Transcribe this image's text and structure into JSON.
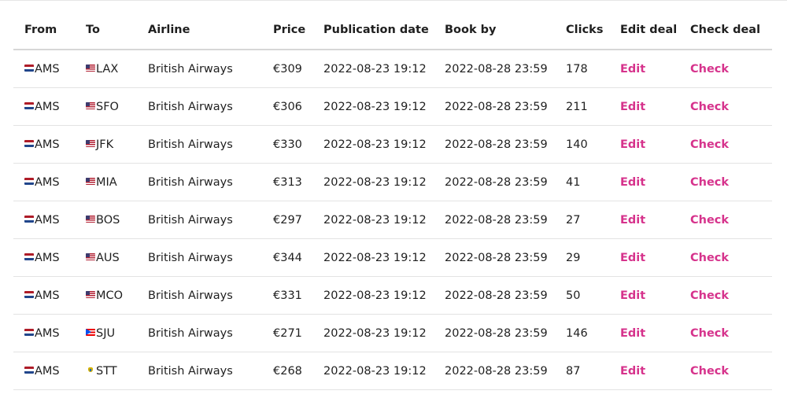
{
  "table": {
    "headers": {
      "from": "From",
      "to": "To",
      "airline": "Airline",
      "price": "Price",
      "publication_date": "Publication date",
      "book_by": "Book by",
      "clicks": "Clicks",
      "edit_deal": "Edit deal",
      "check_deal": "Check deal"
    },
    "rows": [
      {
        "from": "AMS",
        "from_flag": "netherlands-flag-icon",
        "to": "LAX",
        "to_flag": "usa-flag-icon",
        "airline": "British Airways",
        "price": "€309",
        "publication_date": "2022-08-23 19:12",
        "book_by": "2022-08-28 23:59",
        "clicks": "178",
        "edit": "Edit",
        "check": "Check"
      },
      {
        "from": "AMS",
        "from_flag": "netherlands-flag-icon",
        "to": "SFO",
        "to_flag": "usa-flag-icon",
        "airline": "British Airways",
        "price": "€306",
        "publication_date": "2022-08-23 19:12",
        "book_by": "2022-08-28 23:59",
        "clicks": "211",
        "edit": "Edit",
        "check": "Check"
      },
      {
        "from": "AMS",
        "from_flag": "netherlands-flag-icon",
        "to": "JFK",
        "to_flag": "usa-flag-icon",
        "airline": "British Airways",
        "price": "€330",
        "publication_date": "2022-08-23 19:12",
        "book_by": "2022-08-28 23:59",
        "clicks": "140",
        "edit": "Edit",
        "check": "Check"
      },
      {
        "from": "AMS",
        "from_flag": "netherlands-flag-icon",
        "to": "MIA",
        "to_flag": "usa-flag-icon",
        "airline": "British Airways",
        "price": "€313",
        "publication_date": "2022-08-23 19:12",
        "book_by": "2022-08-28 23:59",
        "clicks": "41",
        "edit": "Edit",
        "check": "Check"
      },
      {
        "from": "AMS",
        "from_flag": "netherlands-flag-icon",
        "to": "BOS",
        "to_flag": "usa-flag-icon",
        "airline": "British Airways",
        "price": "€297",
        "publication_date": "2022-08-23 19:12",
        "book_by": "2022-08-28 23:59",
        "clicks": "27",
        "edit": "Edit",
        "check": "Check"
      },
      {
        "from": "AMS",
        "from_flag": "netherlands-flag-icon",
        "to": "AUS",
        "to_flag": "usa-flag-icon",
        "airline": "British Airways",
        "price": "€344",
        "publication_date": "2022-08-23 19:12",
        "book_by": "2022-08-28 23:59",
        "clicks": "29",
        "edit": "Edit",
        "check": "Check"
      },
      {
        "from": "AMS",
        "from_flag": "netherlands-flag-icon",
        "to": "MCO",
        "to_flag": "usa-flag-icon",
        "airline": "British Airways",
        "price": "€331",
        "publication_date": "2022-08-23 19:12",
        "book_by": "2022-08-28 23:59",
        "clicks": "50",
        "edit": "Edit",
        "check": "Check"
      },
      {
        "from": "AMS",
        "from_flag": "netherlands-flag-icon",
        "to": "SJU",
        "to_flag": "puerto-rico-flag-icon",
        "airline": "British Airways",
        "price": "€271",
        "publication_date": "2022-08-23 19:12",
        "book_by": "2022-08-28 23:59",
        "clicks": "146",
        "edit": "Edit",
        "check": "Check"
      },
      {
        "from": "AMS",
        "from_flag": "netherlands-flag-icon",
        "to": "STT",
        "to_flag": "us-virgin-islands-flag-icon",
        "airline": "British Airways",
        "price": "€268",
        "publication_date": "2022-08-23 19:12",
        "book_by": "2022-08-28 23:59",
        "clicks": "87",
        "edit": "Edit",
        "check": "Check"
      }
    ]
  },
  "colors": {
    "link": "#d6338c",
    "text": "#1f1f1f",
    "divider": "#e3e3e3",
    "header_divider": "#d7d7d7"
  }
}
